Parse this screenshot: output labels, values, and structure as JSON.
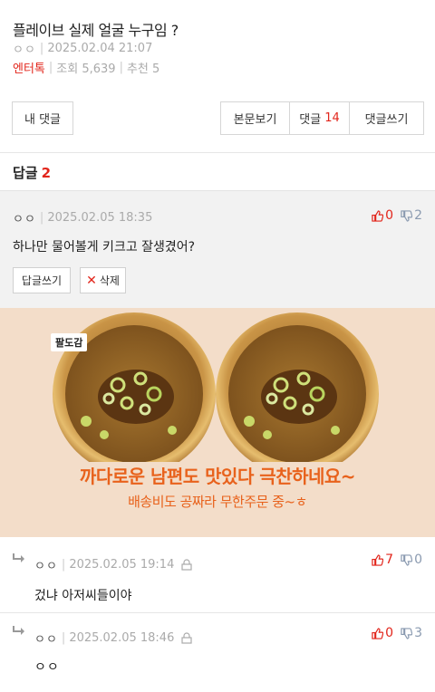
{
  "post": {
    "title": "플레이브 실제 얼굴 누구임 ?",
    "author": "ㅇㅇ",
    "date": "2025.02.04 21:07",
    "category": "엔터톡",
    "views": "조회 5,639",
    "recommend": "추천 5"
  },
  "buttons": {
    "my_comments": "내 댓글",
    "view_post": "본문보기",
    "comments_label": "댓글",
    "comments_count": "14",
    "write_comment": "댓글쓰기"
  },
  "replies": {
    "label": "답글",
    "count": "2"
  },
  "comments": [
    {
      "author": "ㅇㅇ",
      "date": "2025.02.05 18:35",
      "body": "하나만 물어볼게 키크고 잘생겼어?",
      "up": "0",
      "down": "2",
      "reply_btn": "답글쓰기",
      "delete_btn": "삭제"
    },
    {
      "author": "ㅇㅇ",
      "date": "2025.02.05 19:14",
      "body": "겄냐 아저씨들이야",
      "up": "7",
      "down": "0"
    },
    {
      "author": "ㅇㅇ",
      "date": "2025.02.05 18:46",
      "body": "ㅇㅇ",
      "up": "0",
      "down": "3"
    }
  ],
  "ad": {
    "tag": "팔도감",
    "line1": "까다로운 남편도 맛있다 극찬하네요~",
    "line2": "배송비도 공짜라 무한주문 중~ㅎ"
  },
  "colors": {
    "accent_red": "#e2251b",
    "ad_orange": "#e8621c",
    "ad_bg": "#f3ddc9",
    "downvote_blue": "#8a9ab0"
  },
  "icons": {
    "upvote": "thumbs-up-icon",
    "downvote": "thumbs-down-icon",
    "reply": "reply-arrow-icon",
    "lock": "lock-icon",
    "delete": "close-icon"
  }
}
